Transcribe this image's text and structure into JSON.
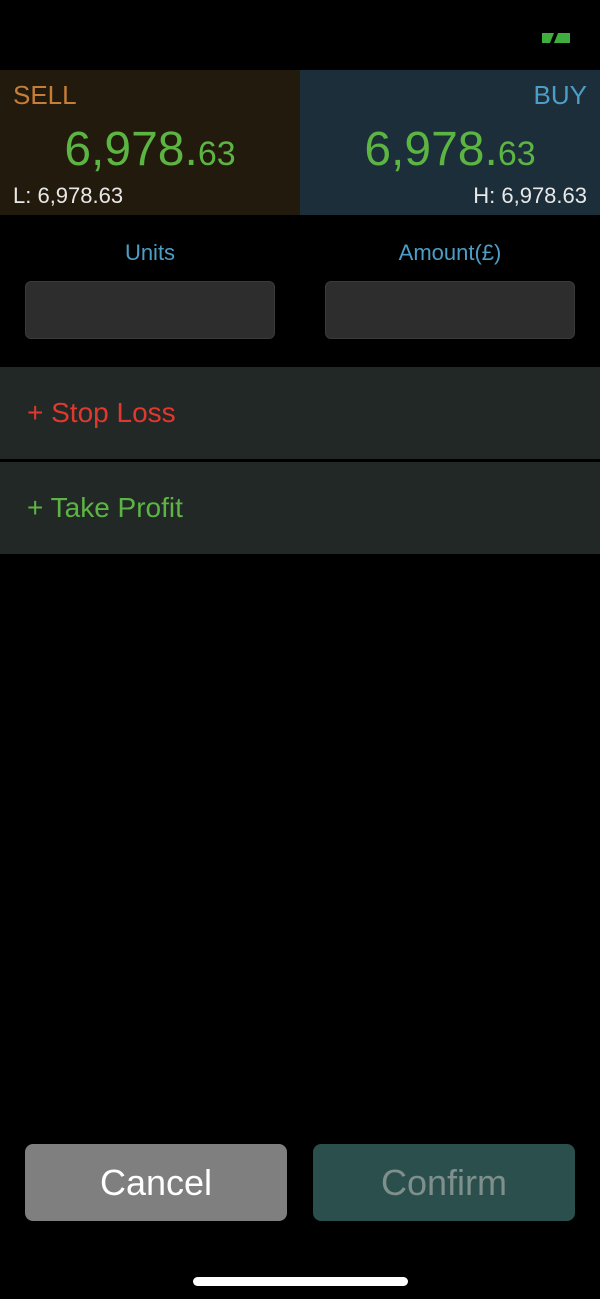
{
  "status": {
    "icon": "connection-icon",
    "icon_color": "#3fae3f"
  },
  "sell": {
    "label": "SELL",
    "price_main": "6,978.",
    "price_decimal": "63",
    "range_label": "L: 6,978.63",
    "color": "#c67d36"
  },
  "buy": {
    "label": "BUY",
    "price_main": "6,978.",
    "price_decimal": "63",
    "range_label": "H: 6,978.63",
    "color": "#4c9ec7"
  },
  "form": {
    "units_label": "Units",
    "units_value": "",
    "amount_label": "Amount(£)",
    "amount_value": ""
  },
  "options": {
    "stop_loss": "+ Stop Loss",
    "take_profit": "+ Take Profit",
    "stop_loss_color": "#e0382e",
    "take_profit_color": "#5cb443"
  },
  "actions": {
    "cancel_label": "Cancel",
    "confirm_label": "Confirm"
  }
}
